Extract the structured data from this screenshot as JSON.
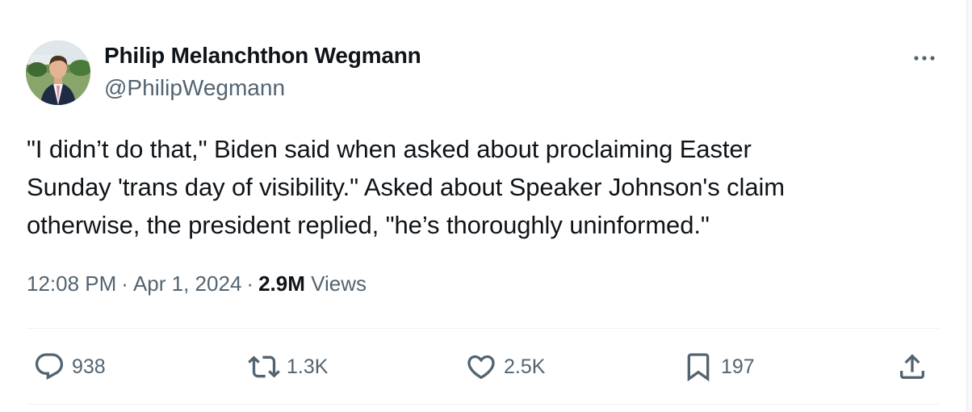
{
  "author": {
    "display_name": "Philip Melanchthon Wegmann",
    "handle": "@PhilipWegmann"
  },
  "tweet": {
    "text_lines": [
      "\"I didn’t do that,\" Biden said when asked about proclaiming Easter",
      "Sunday 'trans day of visibility.\" Asked about Speaker Johnson's claim",
      "otherwise, the president replied, \"he’s thoroughly uninformed.\""
    ]
  },
  "meta": {
    "time": "12:08 PM",
    "separator": "·",
    "date": "Apr 1, 2024",
    "views_count": "2.9M",
    "views_label": "Views"
  },
  "actions": {
    "replies": "938",
    "reposts": "1.3K",
    "likes": "2.5K",
    "bookmarks": "197"
  },
  "icons": {
    "more": "more-icon",
    "reply": "reply-icon",
    "repost": "repost-icon",
    "like": "heart-icon",
    "bookmark": "bookmark-icon",
    "share": "share-icon"
  },
  "colors": {
    "text_primary": "#0f1419",
    "text_secondary": "#536471",
    "divider": "#eff3f4"
  }
}
